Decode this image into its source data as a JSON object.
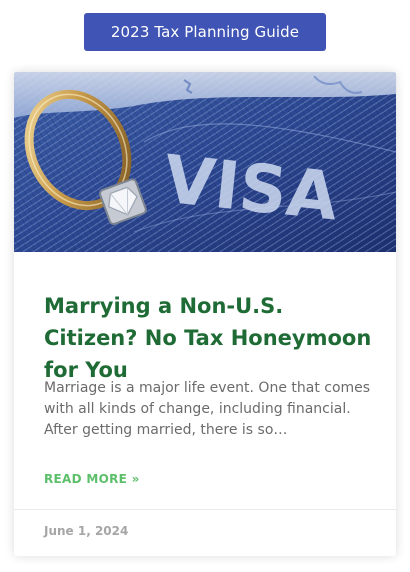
{
  "guide_button": {
    "label": "2023 Tax Planning Guide",
    "color": "#3f54b4"
  },
  "post": {
    "image": {
      "description_icon": "visa-passport-ring-image",
      "visible_text": "VISA"
    },
    "title": "Marrying a Non-U.S. Citizen? No Tax Honeymoon for You",
    "excerpt": "Marriage is a major life event. One that comes with all kinds of change, including financial. After getting married, there is so…",
    "read_more": "READ MORE »",
    "date": "June 1, 2024",
    "title_color": "#1f6b35",
    "link_color": "#5cbf6a"
  }
}
